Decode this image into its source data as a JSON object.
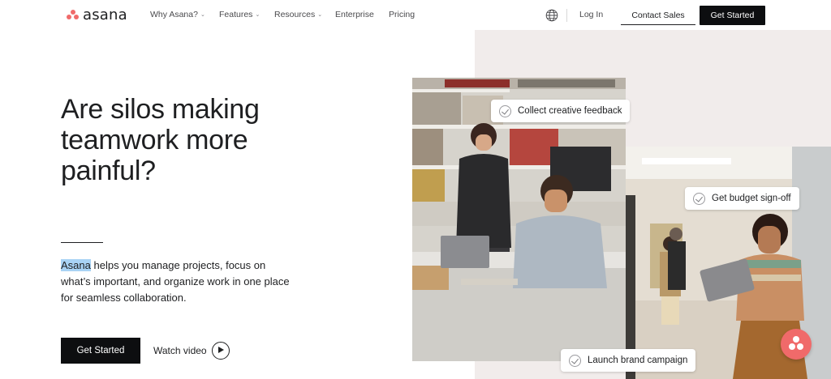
{
  "nav": {
    "logo_text": "asana",
    "items": [
      {
        "label": "Why Asana?",
        "has_caret": true
      },
      {
        "label": "Features",
        "has_caret": true
      },
      {
        "label": "Resources",
        "has_caret": true
      },
      {
        "label": "Enterprise",
        "has_caret": false
      },
      {
        "label": "Pricing",
        "has_caret": false
      }
    ],
    "globe_icon": "globe-icon",
    "login_label": "Log In",
    "contact_sales_label": "Contact Sales",
    "get_started_label": "Get Started"
  },
  "hero": {
    "title": "Are silos making teamwork more painful?",
    "desc_highlight": "Asana",
    "desc_rest": " helps you manage projects, focus on what’s important, and organize work in one place for seamless collaboration.",
    "cta_label": "Get Started",
    "watch_video_label": "Watch video",
    "play_icon": "play-circle-icon"
  },
  "illustration": {
    "chips": [
      {
        "label": "Collect creative feedback",
        "icon": "check-circle-icon"
      },
      {
        "label": "Get budget sign-off",
        "icon": "check-circle-icon"
      },
      {
        "label": "Launch brand campaign",
        "icon": "check-circle-icon"
      }
    ]
  },
  "colors": {
    "brand_coral": "#f06a6a",
    "text_dark": "#1e1f21",
    "button_black": "#0d0e10",
    "panel_bg": "#f1eceb",
    "highlight": "#a9d3f5"
  },
  "fab_icon": "asana-chat-icon"
}
